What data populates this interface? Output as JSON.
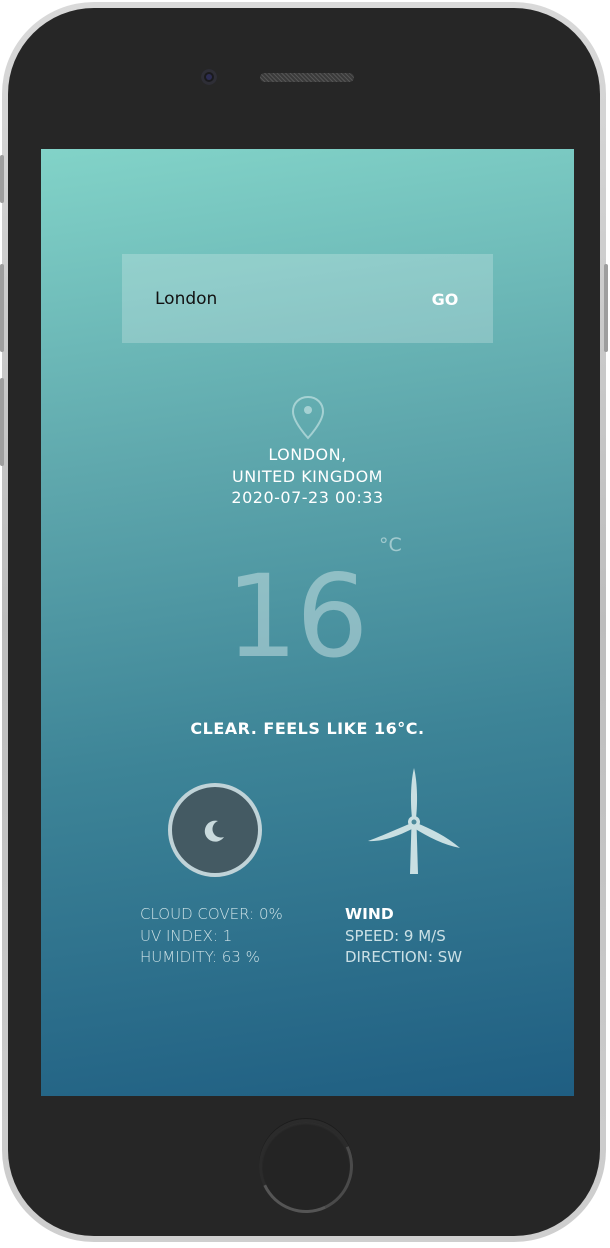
{
  "search": {
    "value": "London",
    "go_label": "GO"
  },
  "location": {
    "city": "LONDON,",
    "country": "UNITED KINGDOM",
    "datetime": "2020-07-23 00:33"
  },
  "weather": {
    "temperature": "16",
    "unit": "°C",
    "description": "CLEAR. FEELS LIKE 16°C.",
    "condition_icon": "moon-icon"
  },
  "conditions": {
    "cloud_cover": "CLOUD COVER: 0%",
    "uv_index": "UV INDEX: 1",
    "humidity": "HUMIDITY: 63 %"
  },
  "wind": {
    "title": "WIND",
    "speed": "SPEED: 9 M/S",
    "direction": "DIRECTION: SW",
    "icon": "wind-turbine-icon"
  },
  "colors": {
    "gradient_top": "#82d3c8",
    "gradient_bottom": "#1f5e82",
    "moon_bg": "#445a63",
    "accent_light": "#c0d3d8"
  }
}
